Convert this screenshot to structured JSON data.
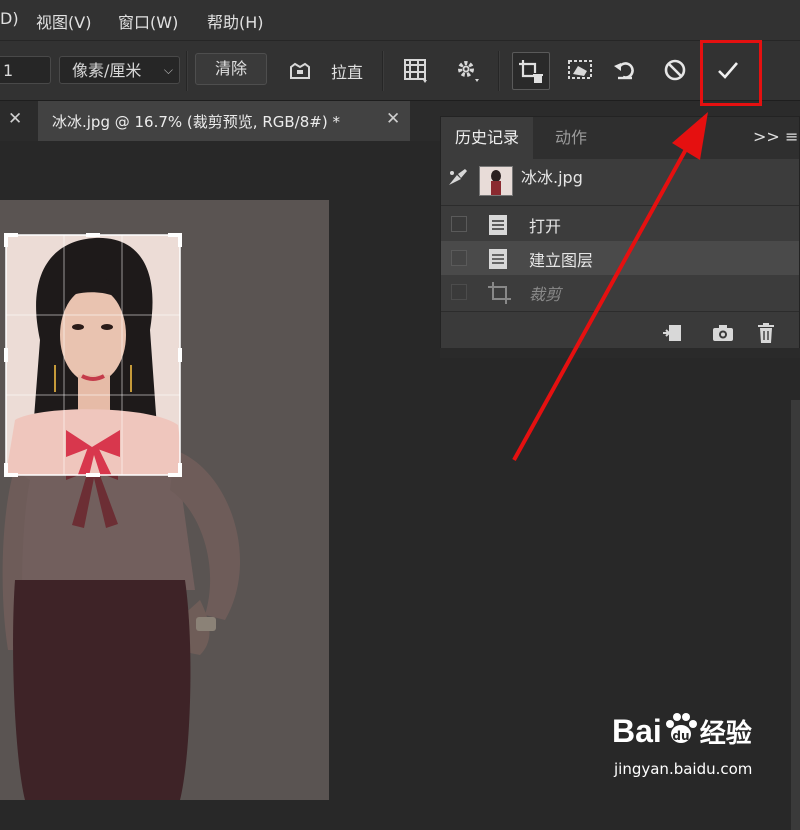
{
  "menu": {
    "items": [
      {
        "label": "D)"
      },
      {
        "label": "视图(V)"
      },
      {
        "label": "窗口(W)"
      },
      {
        "label": "帮助(H)"
      }
    ]
  },
  "options": {
    "ratio_value": "1",
    "unit_select": "像素/厘米",
    "clear_label": "清除",
    "straighten_label": "拉直"
  },
  "tab": {
    "title": "冰冰.jpg @ 16.7% (裁剪预览, RGB/8#) *"
  },
  "history_panel": {
    "tabs": [
      {
        "label": "历史记录",
        "active": true
      },
      {
        "label": "动作",
        "active": false
      }
    ],
    "more_label": ">>",
    "snapshot_name": "冰冰.jpg",
    "items": [
      {
        "label": "打开",
        "icon": "document-icon",
        "state": "normal"
      },
      {
        "label": "建立图层",
        "icon": "document-icon",
        "state": "selected"
      },
      {
        "label": "裁剪",
        "icon": "crop-icon",
        "state": "disabled"
      }
    ]
  },
  "watermark": {
    "brand": "Bai",
    "brand_suffix": "经验",
    "url": "jingyan.baidu.com"
  },
  "colors": {
    "annotation": "#e51010",
    "panel_selected": "#4a4a4a",
    "canvas_bg": "#282828"
  }
}
